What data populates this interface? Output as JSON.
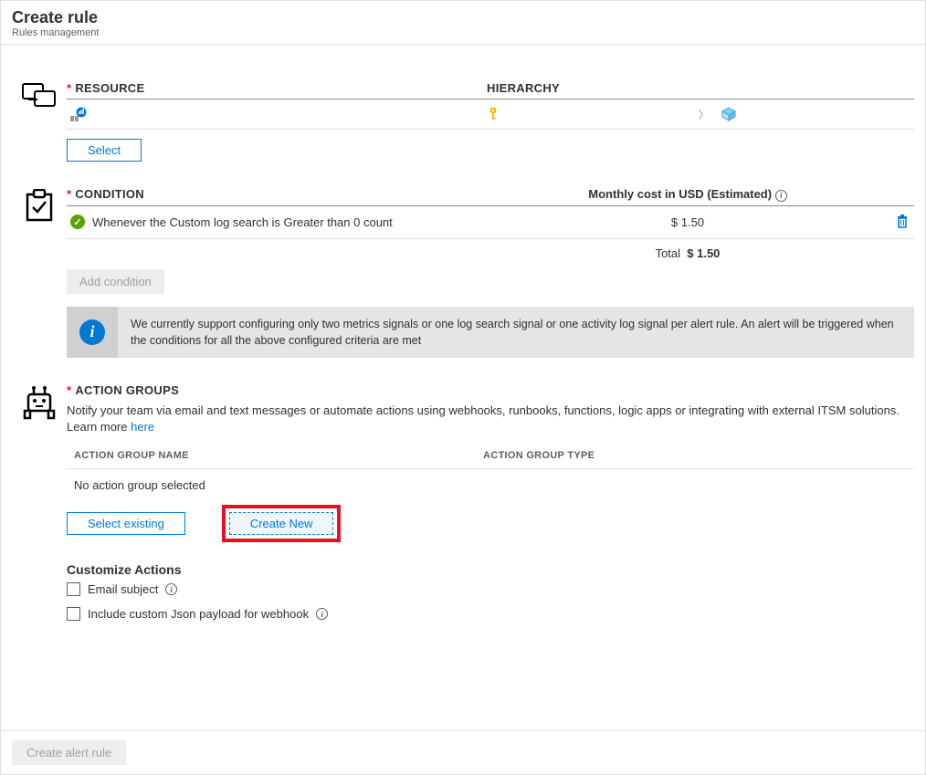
{
  "header": {
    "title": "Create rule",
    "subtitle": "Rules management"
  },
  "resource": {
    "label": "RESOURCE",
    "hierarchy_label": "HIERARCHY",
    "select_btn": "Select"
  },
  "condition": {
    "label": "CONDITION",
    "cost_label": "Monthly cost in USD (Estimated)",
    "item_text": "Whenever the Custom log search is Greater than 0 count",
    "item_cost": "$ 1.50",
    "total_label": "Total",
    "total_value": "$ 1.50",
    "add_btn": "Add condition",
    "info_text": "We currently support configuring only two metrics signals or one log search signal or one activity log signal per alert rule. An alert will be triggered when the conditions for all the above configured criteria are met"
  },
  "action_groups": {
    "label": "ACTION GROUPS",
    "description": "Notify your team via email and text messages or automate actions using webhooks, runbooks, functions, logic apps or integrating with external ITSM solutions. Learn more ",
    "learn_more": "here",
    "col_name": "ACTION GROUP NAME",
    "col_type": "ACTION GROUP TYPE",
    "empty": "No action group selected",
    "select_existing_btn": "Select existing",
    "create_new_btn": "Create New",
    "customize_label": "Customize Actions",
    "cb_email": "Email subject",
    "cb_json": "Include custom Json payload for webhook"
  },
  "footer": {
    "create_btn": "Create alert rule"
  }
}
